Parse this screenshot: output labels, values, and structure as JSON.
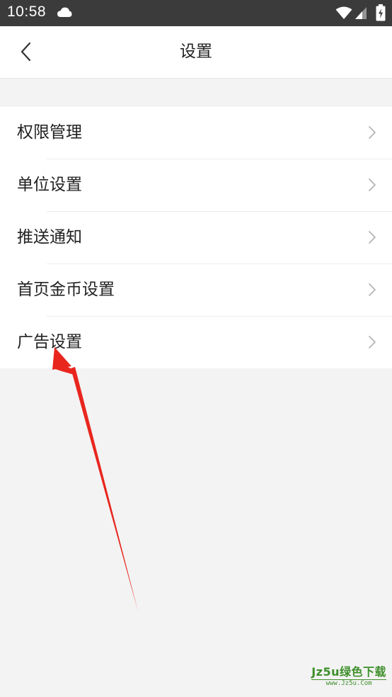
{
  "status_bar": {
    "time": "10:58",
    "icons": [
      "cloud-icon",
      "wifi-icon",
      "signal-icon",
      "battery-icon"
    ]
  },
  "header": {
    "title": "设置",
    "back_icon": "chevron-left-icon"
  },
  "settings": {
    "items": [
      {
        "label": "权限管理"
      },
      {
        "label": "单位设置"
      },
      {
        "label": "推送通知"
      },
      {
        "label": "首页金币设置"
      },
      {
        "label": "广告设置"
      }
    ],
    "chevron_icon": "chevron-right-icon"
  },
  "annotation": {
    "arrow_color": "#e8261e",
    "target": "广告设置"
  },
  "watermark": {
    "title": "Jz5u绿色下载",
    "url": "www.Jz5u.Com"
  },
  "colors": {
    "status_bar": "#3b3b3b",
    "background": "#f3f3f3",
    "surface": "#ffffff",
    "text": "#222222",
    "chevron": "#b5b5b5",
    "watermark": "#3d8f2a"
  }
}
